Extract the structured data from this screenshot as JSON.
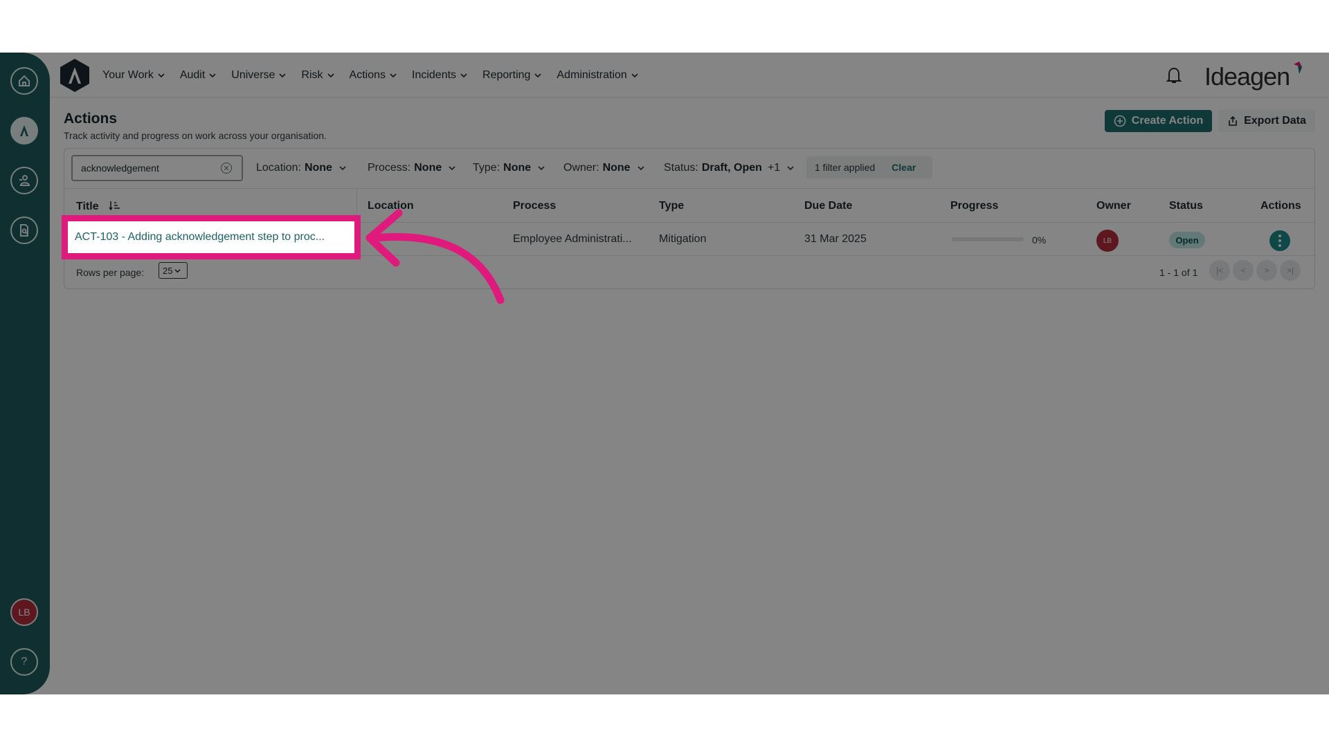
{
  "nav": {
    "items": [
      {
        "label": "Your Work"
      },
      {
        "label": "Audit"
      },
      {
        "label": "Universe"
      },
      {
        "label": "Risk"
      },
      {
        "label": "Actions"
      },
      {
        "label": "Incidents"
      },
      {
        "label": "Reporting"
      },
      {
        "label": "Administration"
      }
    ],
    "brand": "Ideagen"
  },
  "sidebar": {
    "items": [
      "home-icon",
      "app-logo-icon",
      "users-icon",
      "document-search-icon"
    ],
    "avatar": "LB",
    "help": "?"
  },
  "header": {
    "title": "Actions",
    "subtitle": "Track activity and progress on work across your organisation.",
    "create_label": "Create Action",
    "export_label": "Export Data"
  },
  "filters": {
    "search_value": "acknowledgement",
    "location_label": "Location:",
    "location_value": "None",
    "process_label": "Process:",
    "process_value": "None",
    "type_label": "Type:",
    "type_value": "None",
    "owner_label": "Owner:",
    "owner_value": "None",
    "status_label": "Status:",
    "status_value": "Draft, Open",
    "status_extra": "+1",
    "applied_text": "1 filter applied",
    "clear_label": "Clear"
  },
  "table": {
    "columns": [
      "Title",
      "Location",
      "Process",
      "Type",
      "Due Date",
      "Progress",
      "Owner",
      "Status",
      "Actions"
    ],
    "rows": [
      {
        "title": "ACT-103 - Adding acknowledgement step to proc...",
        "location": "",
        "process": "Employee Administrati...",
        "type": "Mitigation",
        "due_date": "31 Mar 2025",
        "progress": 0,
        "progress_text": "0%",
        "owner": "LB",
        "status": "Open"
      }
    ]
  },
  "pagination": {
    "rows_per_page_label": "Rows per page:",
    "rows_per_page": "25",
    "range": "1 - 1 of 1"
  },
  "colors": {
    "sidebar": "#1d5a5c",
    "accent": "#1d6b6d",
    "highlight": "#e0197d",
    "avatar": "#b42b3c"
  }
}
